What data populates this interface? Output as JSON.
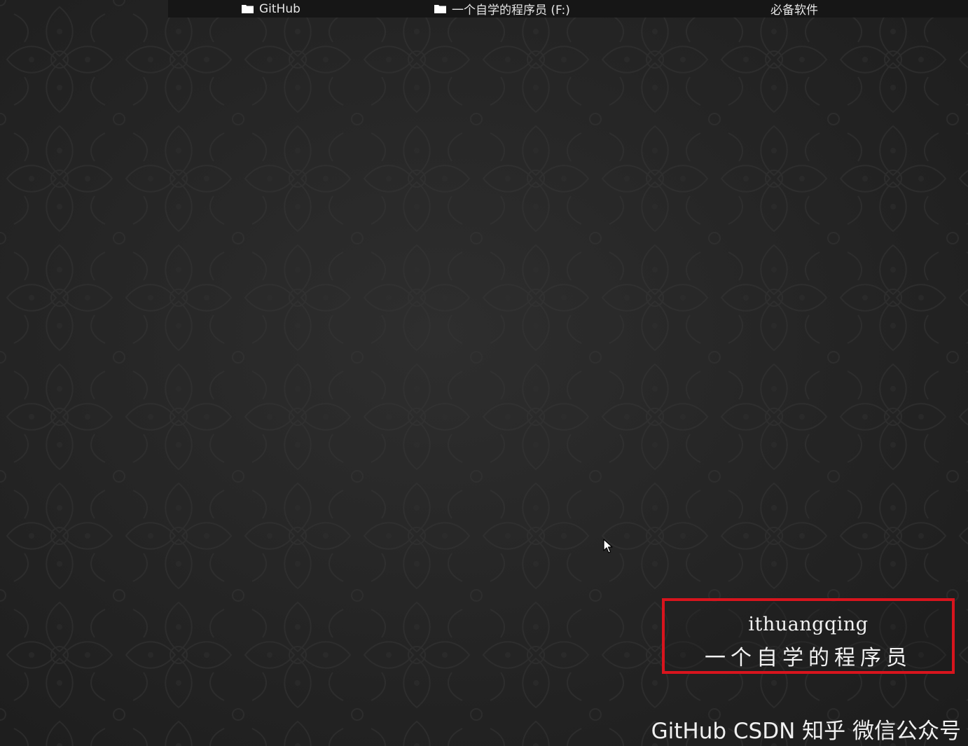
{
  "bookmarks_bar": {
    "items": [
      {
        "label": "GitHub",
        "icon": "folder-icon"
      },
      {
        "label": "一个自学的程序员 (F:)",
        "icon": "folder-icon"
      },
      {
        "label": "必备软件"
      }
    ]
  },
  "watermark": {
    "handle": "ithuangqing",
    "tagline": "一个自学的程序员",
    "border_color": "#d8141d"
  },
  "footer": {
    "platforms": "GitHub CSDN 知乎 微信公众号"
  },
  "colors": {
    "background": "#242424",
    "bookmark_bar": "#161616",
    "text": "#f0f0f0"
  }
}
